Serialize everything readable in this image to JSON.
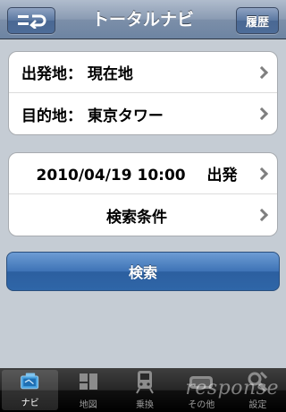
{
  "navbar": {
    "title": "トータルナビ",
    "history_label": "履歴"
  },
  "route": {
    "origin_label": "出発地：",
    "origin_value": "現在地",
    "destination_label": "目的地：",
    "destination_value": "東京タワー"
  },
  "options": {
    "datetime": "2010/04/19 10:00",
    "datetime_type": "出発",
    "conditions_label": "検索条件"
  },
  "search_label": "検索",
  "tabs": [
    {
      "label": "ナビ",
      "icon": "navi-icon",
      "active": true
    },
    {
      "label": "地図",
      "icon": "map-icon",
      "active": false
    },
    {
      "label": "乗換",
      "icon": "train-icon",
      "active": false
    },
    {
      "label": "その他",
      "icon": "etc-icon",
      "active": false
    },
    {
      "label": "設定",
      "icon": "settings-icon",
      "active": false
    }
  ],
  "watermark": "response"
}
